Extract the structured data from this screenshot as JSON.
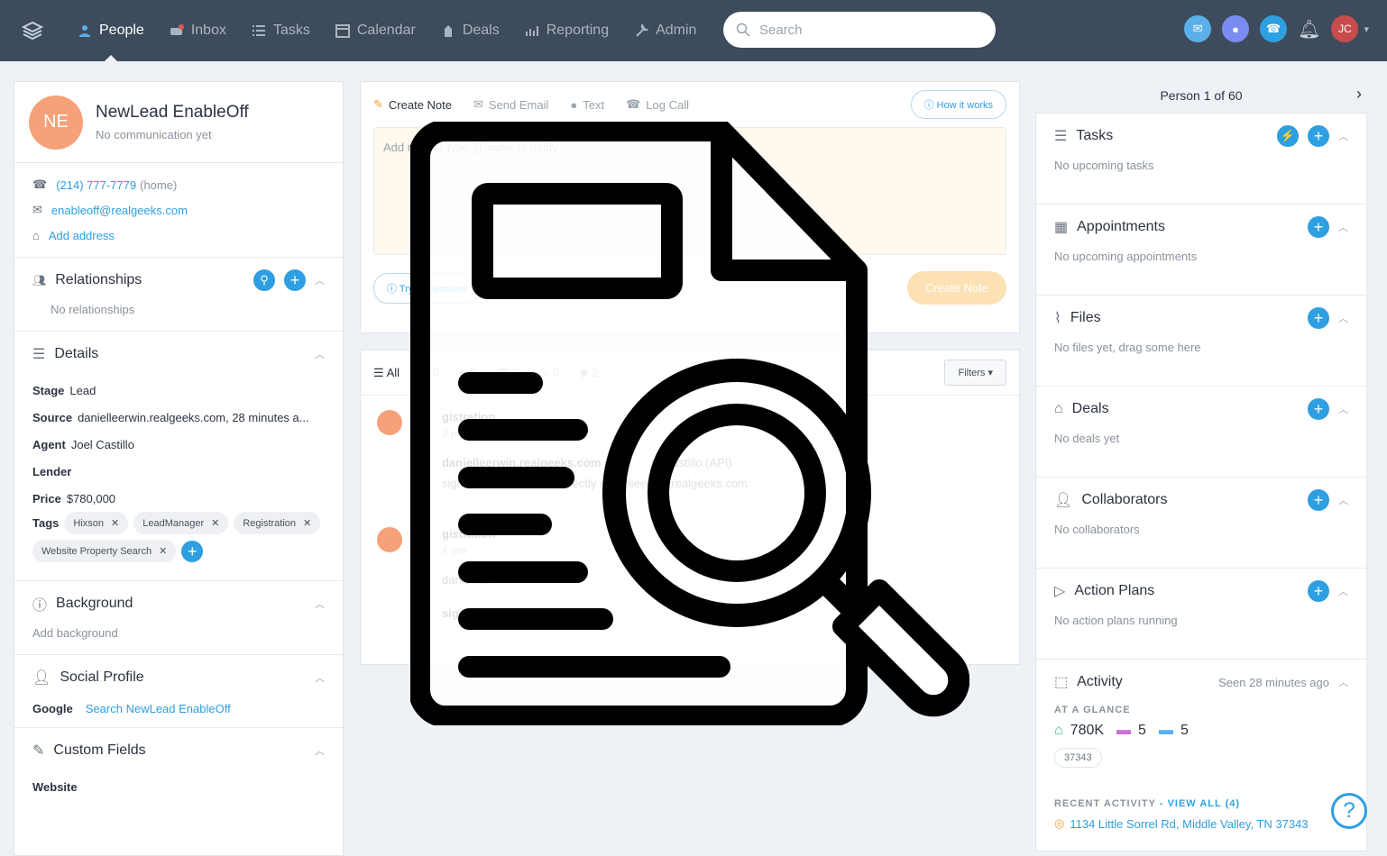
{
  "nav": {
    "items": [
      {
        "label": "People",
        "icon": "people-icon"
      },
      {
        "label": "Inbox",
        "icon": "inbox-icon"
      },
      {
        "label": "Tasks",
        "icon": "tasks-icon"
      },
      {
        "label": "Calendar",
        "icon": "calendar-icon"
      },
      {
        "label": "Deals",
        "icon": "deals-icon"
      },
      {
        "label": "Reporting",
        "icon": "reporting-icon"
      },
      {
        "label": "Admin",
        "icon": "admin-icon"
      }
    ],
    "search_placeholder": "Search",
    "user_initials": "JC"
  },
  "person": {
    "initials": "NE",
    "name": "NewLead EnableOff",
    "status": "No communication yet",
    "phone": "(214) 777-7779",
    "phone_type": "(home)",
    "email": "enableoff@realgeeks.com",
    "add_address": "Add address"
  },
  "relationships": {
    "title": "Relationships",
    "empty": "No relationships"
  },
  "details": {
    "title": "Details",
    "stage_label": "Stage",
    "stage": "Lead",
    "source_label": "Source",
    "source": "danielleerwin.realgeeks.com, 28 minutes a...",
    "agent_label": "Agent",
    "agent": "Joel Castillo",
    "lender_label": "Lender",
    "price_label": "Price",
    "price": "$780,000",
    "tags_label": "Tags",
    "tags": [
      "Hixson",
      "LeadManager",
      "Registration",
      "Website Property Search"
    ]
  },
  "background": {
    "title": "Background",
    "add": "Add background"
  },
  "social": {
    "title": "Social Profile",
    "google_label": "Google",
    "google_link": "Search NewLead EnableOff"
  },
  "custom": {
    "title": "Custom Fields",
    "website_label": "Website"
  },
  "composer": {
    "tabs": [
      "Create Note",
      "Send Email",
      "Text",
      "Log Call"
    ],
    "how": "How it works",
    "placeholder": "Add note or type @name to notify",
    "mentions": "Try @mentions",
    "create": "Create Note"
  },
  "timeline": {
    "filters": [
      {
        "label": "All"
      },
      {
        "label": "0"
      },
      {
        "label": "0"
      },
      {
        "label": "0"
      },
      {
        "label": "0"
      },
      {
        "label": "2"
      }
    ],
    "filters_btn": "Filters",
    "items": [
      {
        "title": "gistration",
        "time": "3 pm",
        "line1": "danielleerwin.realgeeks.com",
        "line1b": "yers",
        "line1c": "el Castillo (API)",
        "line2": "signed to Joel Castillo directly",
        "line2b": "danielleerwin.realgeeks.com"
      },
      {
        "title": "gistration",
        "time": "4 pm",
        "line1": "danielleerwin - ",
        "link": "view email",
        "line2": "signe"
      }
    ]
  },
  "right": {
    "pager": "Person 1 of 60",
    "sections": [
      {
        "title": "Tasks",
        "empty": "No upcoming tasks"
      },
      {
        "title": "Appointments",
        "empty": "No upcoming appointments"
      },
      {
        "title": "Files",
        "empty": "No files yet, drag some here"
      },
      {
        "title": "Deals",
        "empty": "No deals yet"
      },
      {
        "title": "Collaborators",
        "empty": "No collaborators"
      },
      {
        "title": "Action Plans",
        "empty": "No action plans running"
      }
    ],
    "activity": {
      "title": "Activity",
      "seen": "Seen 28 minutes ago",
      "glance": "AT A GLANCE",
      "price": "780K",
      "beds": "5",
      "baths": "5",
      "zip": "37343",
      "recent": "RECENT ACTIVITY",
      "view_all": "VIEW ALL (4)",
      "address": "1134 Little Sorrel Rd, Middle Valley, TN 37343"
    }
  },
  "colors": {
    "accent": "#2e9fe0",
    "topbar": "#3d4b5c",
    "avatar": "#f6a179"
  }
}
